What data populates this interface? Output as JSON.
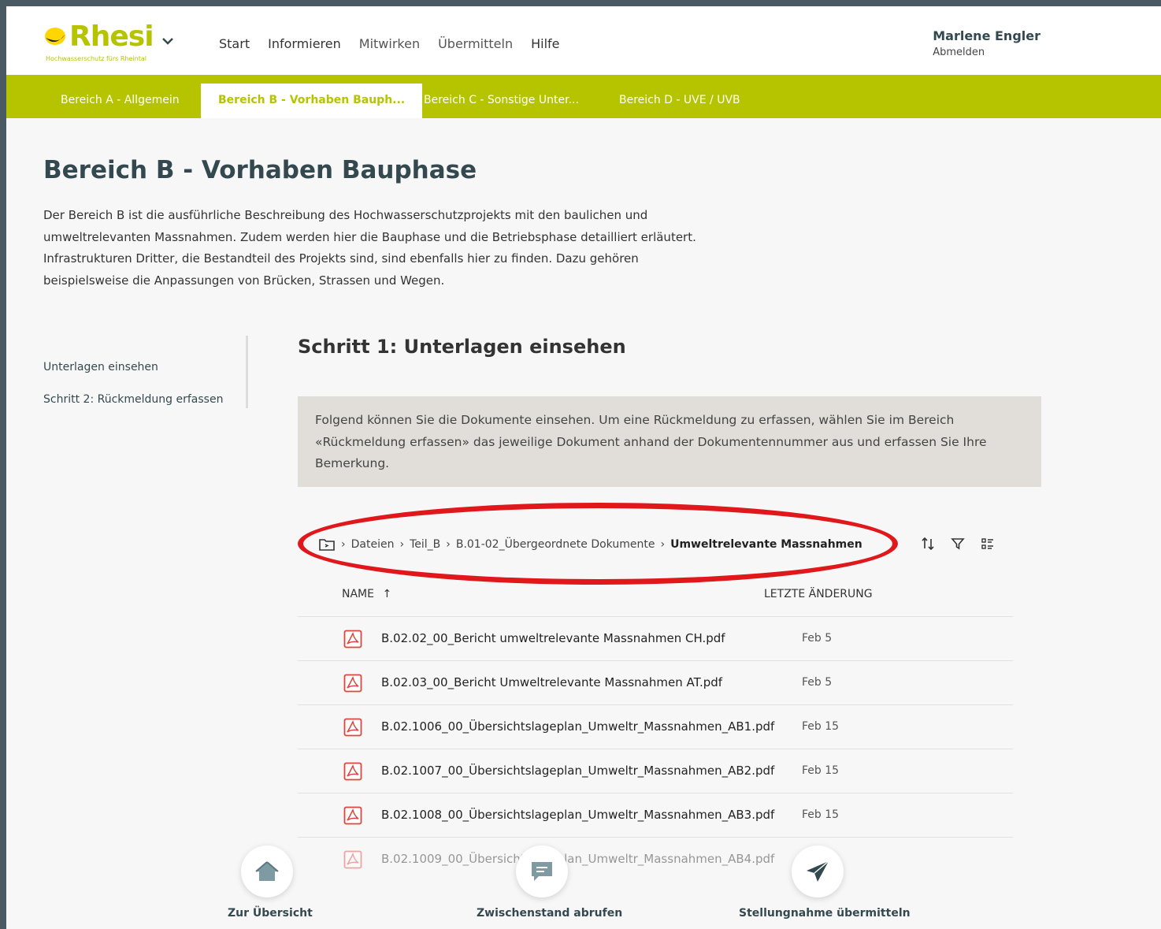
{
  "header": {
    "logo_text": "Rhesi",
    "logo_tagline": "Hochwasserschutz fürs Rheintal",
    "nav": [
      "Start",
      "Informieren",
      "Mitwirken",
      "Übermitteln",
      "Hilfe"
    ],
    "user_name": "Marlene Engler",
    "logout": "Abmelden"
  },
  "tabs": [
    {
      "label": "Bereich A - Allgemein",
      "active": false
    },
    {
      "label": "Bereich B - Vorhaben Bauph...",
      "active": true
    },
    {
      "label": "Bereich C - Sonstige Unter...",
      "active": false
    },
    {
      "label": "Bereich D - UVE / UVB",
      "active": false
    }
  ],
  "main": {
    "title": "Bereich B - Vorhaben Bauphase",
    "intro": "Der Bereich B ist die ausführliche Beschreibung des Hochwasserschutzprojekts mit den baulichen und umweltrelevanten Massnahmen. Zudem werden hier die Bauphase und die Betriebsphase detailliert erläutert. Infrastrukturen Dritter, die Bestandteil des Projekts sind, sind ebenfalls hier zu finden. Dazu gehören beispielsweise die Anpassungen von Brücken, Strassen und Wegen.",
    "step_title": "Schritt 1: Unterlagen einsehen",
    "info": "Folgend können Sie die Dokumente einsehen. Um eine Rückmeldung zu erfassen, wählen Sie im Bereich «Rückmeldung erfassen» das jeweilige Dokument anhand der Dokumentennummer aus und erfassen Sie Ihre Bemerkung."
  },
  "sidenav": [
    "Unterlagen einsehen",
    "Schritt 2: Rückmeldung erfassen"
  ],
  "breadcrumb": {
    "items": [
      "Dateien",
      "Teil_B",
      "B.01-02_Übergeordnete Dokumente"
    ],
    "current": "Umweltrelevante Massnahmen"
  },
  "table": {
    "col_name": "NAME",
    "sort_arrow": "↑",
    "col_date": "LETZTE ÄNDERUNG",
    "rows": [
      {
        "name": "B.02.02_00_Bericht umweltrelevante Massnahmen CH.pdf",
        "date": "Feb 5"
      },
      {
        "name": "B.02.03_00_Bericht Umweltrelevante Massnahmen AT.pdf",
        "date": "Feb 5"
      },
      {
        "name": "B.02.1006_00_Übersichtslageplan_Umweltr_Massnahmen_AB1.pdf",
        "date": "Feb 15"
      },
      {
        "name": "B.02.1007_00_Übersichtslageplan_Umweltr_Massnahmen_AB2.pdf",
        "date": "Feb 15"
      },
      {
        "name": "B.02.1008_00_Übersichtslageplan_Umweltr_Massnahmen_AB3.pdf",
        "date": "Feb 15"
      },
      {
        "name": "B.02.1009_00_Übersichtslageplan_Umweltr_Massnahmen_AB4.pdf",
        "date": ""
      }
    ]
  },
  "actions": {
    "overview": "Zur Übersicht",
    "interim": "Zwischenstand abrufen",
    "submit": "Stellungnahme übermitteln"
  },
  "colors": {
    "brand": "#b6c400",
    "heading": "#34494f",
    "highlight": "#e0181b",
    "pdf": "#e0443f"
  }
}
